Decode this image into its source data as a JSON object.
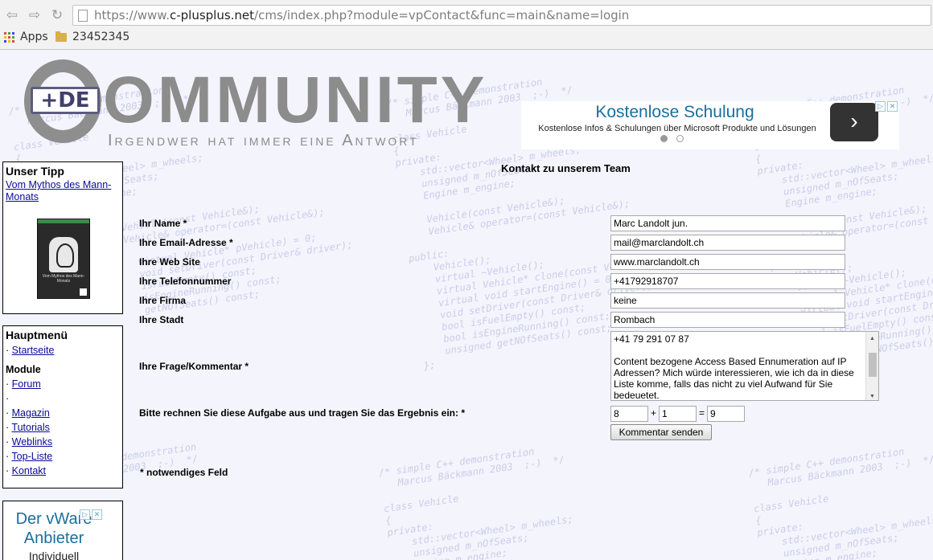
{
  "browser": {
    "url_prefix": "https://www.",
    "url_domain": "c-plusplus.net",
    "url_path": "/cms/index.php?module=vpContact&func=main&name=login",
    "bookmarks": [
      {
        "label": "Apps",
        "icon": "apps-grid-icon"
      },
      {
        "label": "23452345",
        "icon": "folder-icon"
      }
    ]
  },
  "logo": {
    "badge": "+DE",
    "title": "OMMUNITY",
    "subtitle": "Irgendwer hat immer eine Antwort"
  },
  "ad": {
    "title": "Kostenlose Schulung",
    "text": "Kostenlose Infos & Schulungen über Microsoft Produkte und Lösungen",
    "arrow": "›"
  },
  "tip_box": {
    "title": "Unser Tipp",
    "link": "Vom Mythos des Mann-Monats",
    "book_caption": "Vom Mythos des Mann-Monats"
  },
  "main_menu": {
    "title": "Hauptmenü",
    "items": [
      {
        "label": "Startseite"
      }
    ],
    "modules_title": "Module",
    "modules": [
      {
        "label": "Forum"
      },
      {
        "label": ""
      },
      {
        "label": "Magazin"
      },
      {
        "label": "Tutorials"
      },
      {
        "label": "Weblinks"
      },
      {
        "label": "Top-Liste"
      },
      {
        "label": "Kontakt"
      }
    ]
  },
  "side_ad": {
    "title": "Der vWare Anbieter",
    "text": "Individuell"
  },
  "form": {
    "title": "Kontakt zu unserem Team",
    "fields": [
      {
        "label": "Ihr Name *",
        "value": "Marc Landolt jun."
      },
      {
        "label": "Ihre Email-Adresse *",
        "value": "mail@marclandolt.ch"
      },
      {
        "label": "Ihre Web Site",
        "value": "www.marclandolt.ch"
      },
      {
        "label": "Ihre Telefonnummer",
        "value": "+41792918707"
      },
      {
        "label": "Ihre Firma",
        "value": "keine"
      },
      {
        "label": "Ihre Stadt",
        "value": "Rombach"
      }
    ],
    "comment_label": "Ihre Frage/Kommentar *",
    "comment_line1": "+41 79 291 07 87",
    "comment_line2": "Content bezogene Access Based Ennumeration auf IP Adressen? Mich würde interessieren, wie ich da in diese Liste komme, falls das nicht zu viel Aufwand für Sie bedeuetet.",
    "captcha_label": "Bitte rechnen Sie diese Aufgabe aus und tragen Sie das Ergebnis ein: *",
    "captcha_a": "8",
    "captcha_op": "+",
    "captcha_b": "1",
    "captcha_eq": "=",
    "captcha_result": "9",
    "submit_label": "Kommentar senden",
    "required_note": "* notwendiges Feld"
  }
}
